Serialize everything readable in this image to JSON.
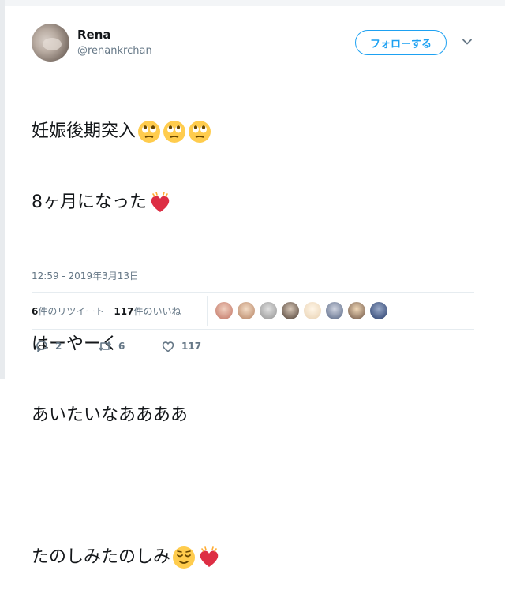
{
  "user": {
    "name": "Rena",
    "handle": "@renankrchan"
  },
  "follow_label": "フォローする",
  "tweet": {
    "line1": "妊娠後期突入",
    "line2": "8ヶ月になった",
    "line3": "はーやーく",
    "line4": "あいたいなああああ",
    "line5": "たのしみたのしみ"
  },
  "timestamp": "12:59 - 2019年3月13日",
  "stats": {
    "retweets_count": "6",
    "retweets_label": "件のリツイート",
    "likes_count": "117",
    "likes_label": "件のいいね"
  },
  "actions": {
    "reply_count": "2",
    "retweet_count": "6",
    "like_count": "117"
  },
  "icons": [
    "chevron-down-icon",
    "reply-icon",
    "retweet-icon",
    "heart-icon",
    "eyes-rolling-emoji",
    "beating-heart-emoji",
    "relieved-face-emoji"
  ],
  "colors": {
    "accent": "#1da1f2",
    "secondary_text": "#657786",
    "heart": "#e0245e"
  }
}
